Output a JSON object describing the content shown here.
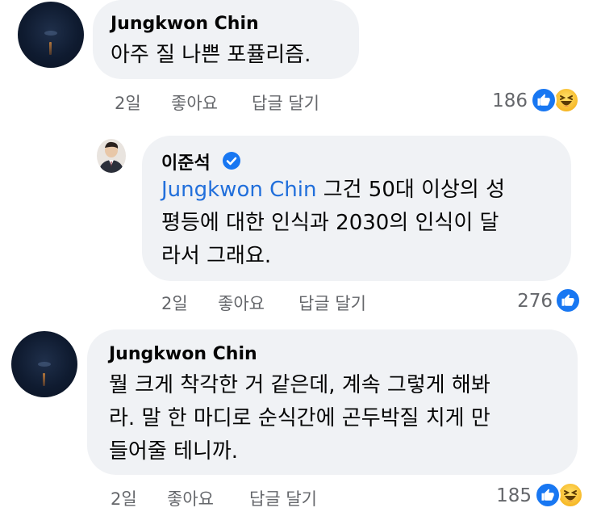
{
  "comments": [
    {
      "author": "Jungkwon Chin",
      "lines": [
        "아주 질 나쁜 포퓰리즘."
      ],
      "actions": {
        "time": "2일",
        "like": "좋아요",
        "reply": "답글 달기"
      },
      "reaction_count": "186",
      "reactions": [
        "like-icon",
        "haha-icon"
      ]
    },
    {
      "author": "이준석",
      "verified": true,
      "mention": "Jungkwon Chin",
      "lines": [
        " 그건 50대 이상의 성",
        "평등에 대한 인식과 2030의 인식이 달",
        "라서 그래요."
      ],
      "actions": {
        "time": "2일",
        "like": "좋아요",
        "reply": "답글 달기"
      },
      "reaction_count": "276",
      "reactions": [
        "like-icon"
      ]
    },
    {
      "author": "Jungkwon Chin",
      "lines": [
        "뭘  크게 착각한 거 같은데, 계속 그렇게 해봐",
        "라. 말 한 마디로 순식간에 곤두박질 치게 만",
        "들어줄 테니까."
      ],
      "actions": {
        "time": "2일",
        "like": "좋아요",
        "reply": "답글 달기"
      },
      "reaction_count": "185",
      "reactions": [
        "like-icon",
        "haha-icon"
      ]
    }
  ],
  "colors": {
    "bubble": "#f0f2f5",
    "mention": "#216fdb",
    "meta": "#65676b",
    "like": "#1877f2",
    "haha": "#f7b928"
  }
}
